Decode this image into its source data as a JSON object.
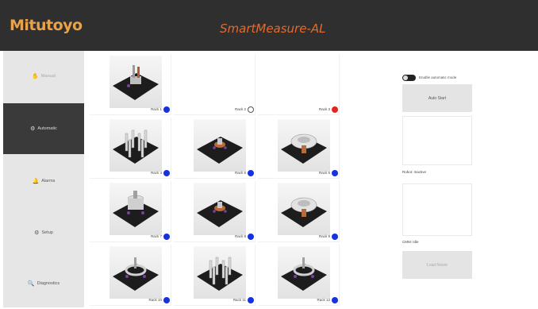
{
  "header": {
    "brand": "Mitutoyo",
    "app_title": "SmartMeasure-AL"
  },
  "sidebar": {
    "items": [
      {
        "label": "Manual",
        "icon": "hand-icon"
      },
      {
        "label": "Automatic",
        "icon": "robot-icon"
      },
      {
        "label": "Alarms",
        "icon": "bell-icon"
      },
      {
        "label": "Setup",
        "icon": "gear-icon"
      },
      {
        "label": "Diagnostics",
        "icon": "magnifier-icon"
      }
    ],
    "active": "Automatic",
    "disabled": [
      "Manual"
    ]
  },
  "racks": [
    {
      "label": "Rack 1",
      "status": "active",
      "part": "pins"
    },
    {
      "label": "Rack 2",
      "status": "empty",
      "part": "none"
    },
    {
      "label": "Rack 3",
      "status": "error",
      "part": "none"
    },
    {
      "label": "Rack 4",
      "status": "active",
      "part": "columns"
    },
    {
      "label": "Rack 5",
      "status": "active",
      "part": "small"
    },
    {
      "label": "Rack 6",
      "status": "active",
      "part": "gear"
    },
    {
      "label": "Rack 7",
      "status": "active",
      "part": "cylinder"
    },
    {
      "label": "Rack 8",
      "status": "active",
      "part": "small"
    },
    {
      "label": "Rack 9",
      "status": "active",
      "part": "gear"
    },
    {
      "label": "Rack 10",
      "status": "active",
      "part": "ring"
    },
    {
      "label": "Rack 11",
      "status": "active",
      "part": "columns"
    },
    {
      "label": "Rack 12",
      "status": "active",
      "part": "ring"
    }
  ],
  "status_colors": {
    "active": "#1730e0",
    "empty": "#ffffff",
    "error": "#e5241c"
  },
  "right_panel": {
    "toggle_label": "Enable automatic mode",
    "auto_start_label": "Auto Start",
    "robot_status": "Robot: Inactive",
    "cmm_status": "CMM: Idle",
    "load_fixture_label": "Load fixture"
  }
}
